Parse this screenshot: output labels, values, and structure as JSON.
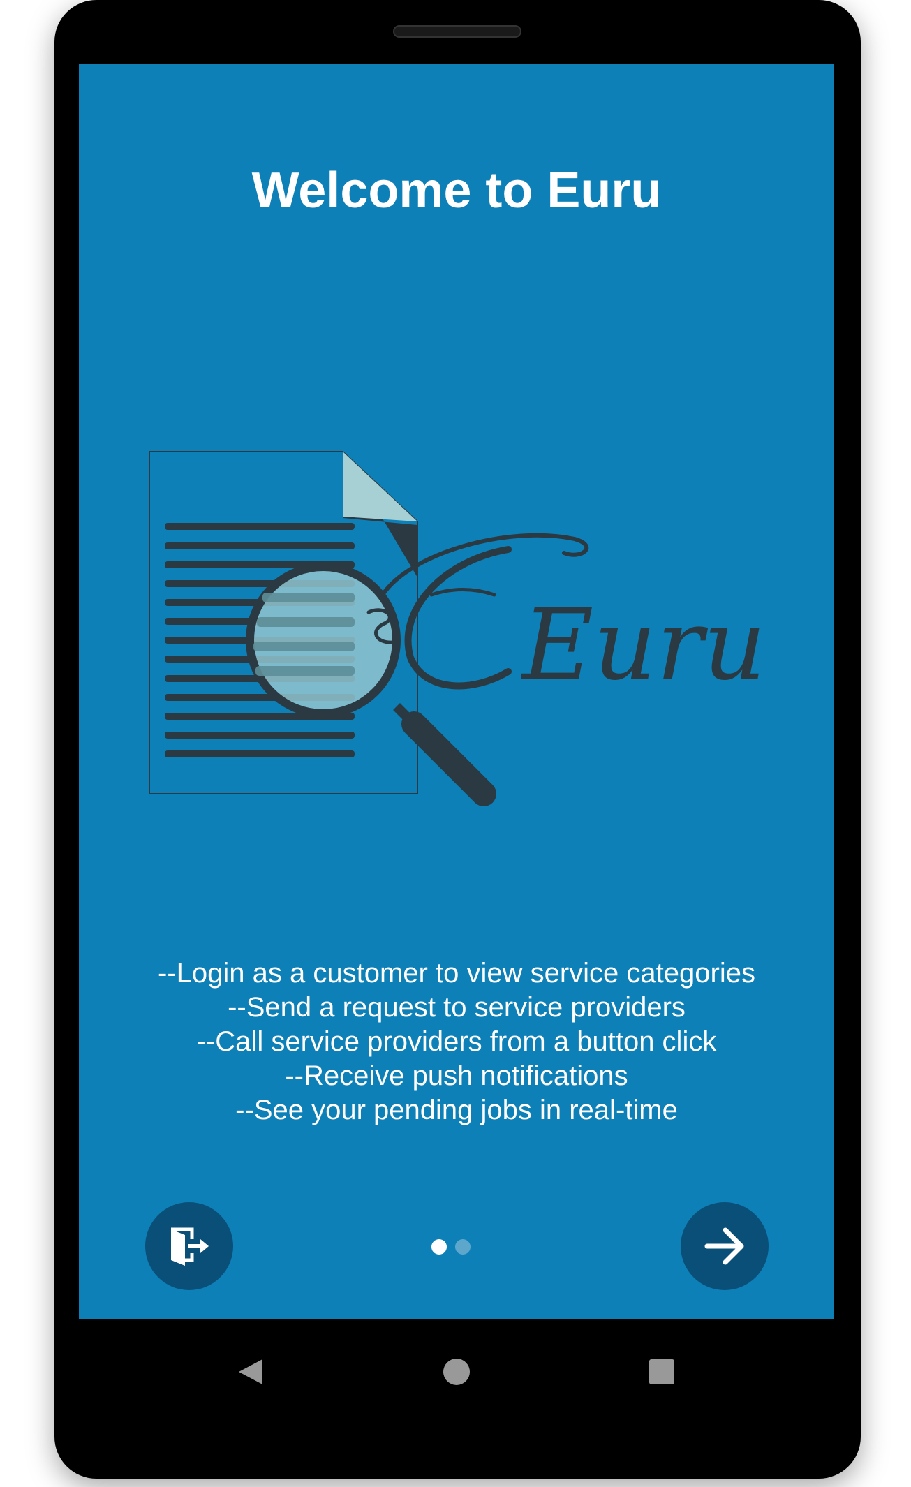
{
  "welcome": {
    "title": "Welcome to Euru"
  },
  "logo": {
    "wordmark": "Euru",
    "colors": {
      "ink": "#2b3a42",
      "lens": "#8fc4cf",
      "fold": "#a6d0d4"
    }
  },
  "features": [
    "--Login as a customer to view service categories",
    "--Send a request to service providers",
    "--Call service providers from a button click",
    "--Receive push notifications",
    "--See your pending jobs in real-time"
  ],
  "pager": {
    "total_pages": 2,
    "current_page": 1
  },
  "actions": {
    "skip_icon": "exit-door-icon",
    "next_icon": "arrow-right-icon"
  },
  "nav_bar": {
    "back_icon": "triangle-back-icon",
    "home_icon": "circle-home-icon",
    "recents_icon": "square-recents-icon"
  },
  "colors": {
    "background": "#0e80b8",
    "fab": "#0a4f78",
    "text": "#ffffff",
    "dot_inactive": "#5ea7cc"
  }
}
